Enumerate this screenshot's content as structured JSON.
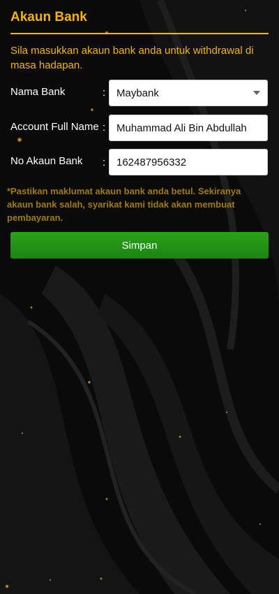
{
  "header": {
    "title": "Akaun Bank"
  },
  "intro": "Sila masukkan akaun bank anda untuk withdrawal di masa hadapan.",
  "form": {
    "colon": ":",
    "bank": {
      "label": "Nama Bank",
      "value": "Maybank"
    },
    "full_name": {
      "label": "Account Full Name",
      "value": "Muhammad Ali Bin Abdullah"
    },
    "account_no": {
      "label": "No Akaun Bank",
      "value": "162487956332"
    }
  },
  "notice": "*Pastikan maklumat akaun bank anda betul. Sekiranya akaun bank salah, syarikat kami tidak akan membuat pembayaran.",
  "submit_label": "Simpan",
  "colors": {
    "accent": "#f5b40a",
    "button": "#1f9a14",
    "background": "#0b0b0b"
  }
}
